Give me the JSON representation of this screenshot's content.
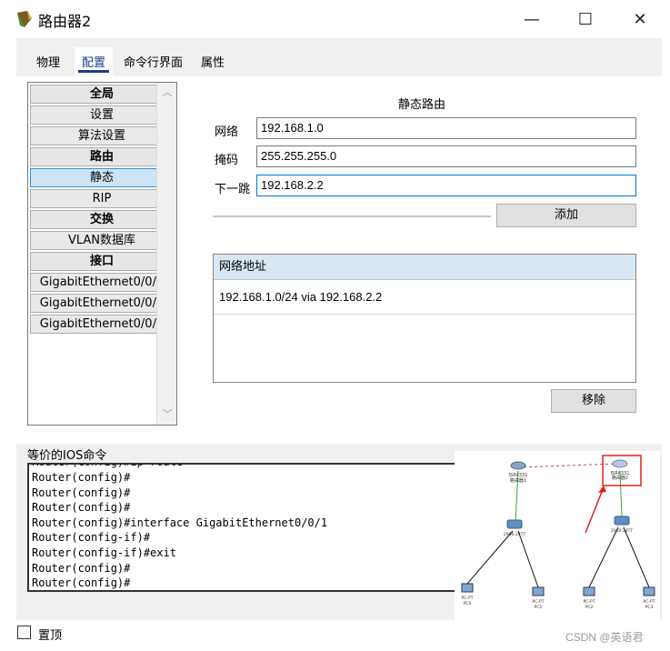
{
  "window": {
    "title": "路由器2",
    "minimize_glyph": "—",
    "maximize_glyph": "☐",
    "close_glyph": "✕"
  },
  "tabs": [
    {
      "label": "物理",
      "active": false
    },
    {
      "label": "配置",
      "active": true
    },
    {
      "label": "命令行界面",
      "active": false
    },
    {
      "label": "属性",
      "active": false
    }
  ],
  "nav": {
    "items": [
      {
        "label": "全局",
        "type": "header"
      },
      {
        "label": "设置",
        "type": "item"
      },
      {
        "label": "算法设置",
        "type": "item"
      },
      {
        "label": "路由",
        "type": "header"
      },
      {
        "label": "静态",
        "type": "item",
        "selected": true
      },
      {
        "label": "RIP",
        "type": "item"
      },
      {
        "label": "交换",
        "type": "header"
      },
      {
        "label": "VLAN数据库",
        "type": "item"
      },
      {
        "label": "接口",
        "type": "header"
      },
      {
        "label": "GigabitEthernet0/0/0",
        "type": "item"
      },
      {
        "label": "GigabitEthernet0/0/1",
        "type": "item"
      },
      {
        "label": "GigabitEthernet0/0/2",
        "type": "item"
      }
    ]
  },
  "static_route": {
    "title": "静态路由",
    "network_label": "网络",
    "network_value": "192.168.1.0",
    "mask_label": "掩码",
    "mask_value": "255.255.255.0",
    "next_hop_label": "下一跳",
    "next_hop_value": "192.168.2.2",
    "add_button": "添加",
    "list_header": "网络地址",
    "routes": [
      "192.168.1.0/24 via 192.168.2.2"
    ],
    "remove_button": "移除"
  },
  "ios": {
    "label": "等价的IOS命令",
    "lines": [
      "Router(config)#",
      "Router(config)#",
      "Router(config)#",
      "Router(config)#interface GigabitEthernet0/0/1",
      "Router(config-if)#",
      "Router(config-if)#exit",
      "Router(config)#",
      "Router(config)#"
    ]
  },
  "topology": {
    "devices": [
      "路由器1",
      "路由器2",
      "PC0",
      "PC1",
      "PC2",
      "PC3"
    ],
    "highlight_color": "#e02020",
    "link_color": "#1a1a1a"
  },
  "footer": {
    "pin_label": "置顶",
    "watermark": "CSDN @英语君"
  }
}
